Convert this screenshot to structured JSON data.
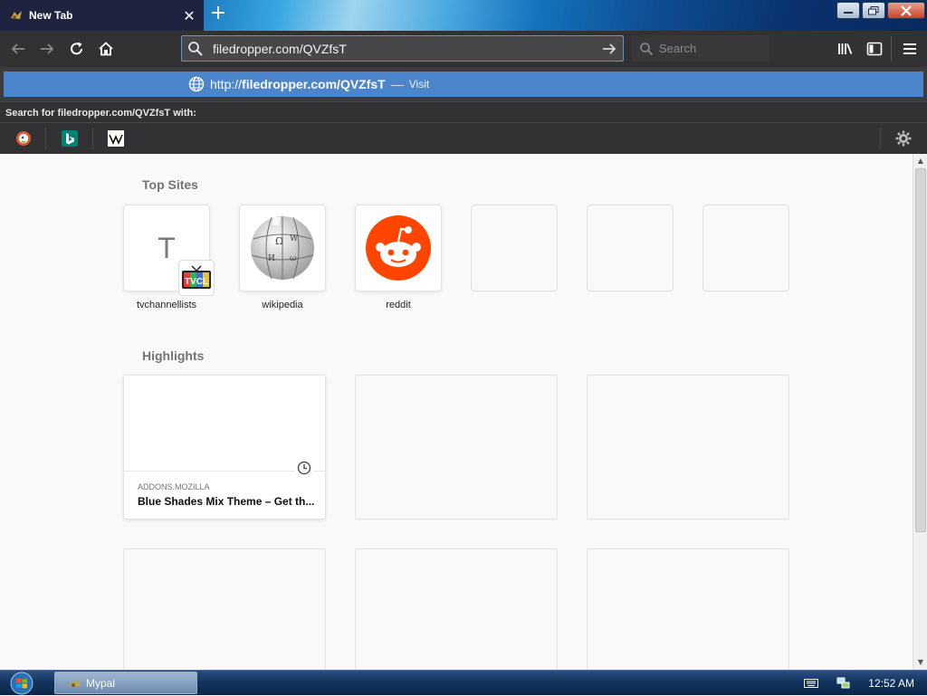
{
  "browser": {
    "tab": {
      "title": "New Tab",
      "close_glyph": "✕",
      "favicon": "mypal-icon"
    },
    "new_tab_glyph": "+",
    "url": "filedropper.com/QVZfsT",
    "search_placeholder": "Search"
  },
  "dropdown": {
    "suggestion": {
      "prefix": "http://",
      "host": "filedropper.com/QVZfsT",
      "separator": "—",
      "action": "Visit"
    },
    "search_with": "Search for filedropper.com/QVZfsT with:",
    "engines": [
      "duckduckgo-icon",
      "bing-icon",
      "wikipedia-icon"
    ]
  },
  "newtab": {
    "top_sites_title": "Top Sites",
    "top_sites": [
      {
        "label": "tvchannellists",
        "letter": "T",
        "badge": "TVCL"
      },
      {
        "label": "wikipedia"
      },
      {
        "label": "reddit"
      },
      {
        "label": ""
      },
      {
        "label": ""
      },
      {
        "label": ""
      }
    ],
    "highlights_title": "Highlights",
    "highlights": [
      {
        "source": "ADDONS.MOZILLA",
        "title": "Blue Shades Mix Theme – Get th..."
      }
    ]
  },
  "taskbar": {
    "task_label": "Mypal",
    "time": "12:52 AM"
  },
  "colors": {
    "accent": "#4b86cc",
    "toolbar": "#323234",
    "tab": "#202340",
    "reddit": "#ff4500"
  }
}
